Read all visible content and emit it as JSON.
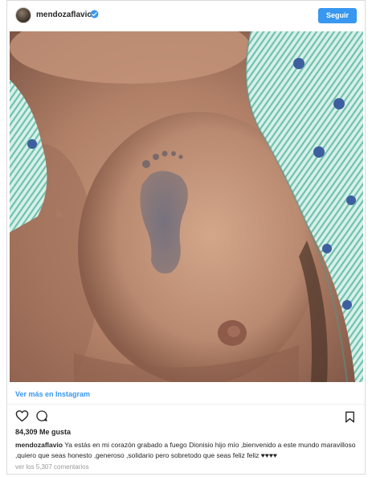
{
  "post": {
    "username": "mendozaflavio",
    "follow_label": "Seguir",
    "view_more": "Ver más en Instagram",
    "likes": "84,309 Me gusta",
    "caption_user": "mendozaflavio",
    "caption_text": "Ya estás en mi corazón grabado a fuego Dionisio hijo mío ,bienvenido a este mundo maravilloso ,quiero que seas honesto ,generoso ,solidario pero sobretodo que seas feliz feliz ♥♥♥♥",
    "view_comments": "ver los 5,307 comentarios"
  },
  "icons": {
    "verified": "verified-badge-icon",
    "like": "heart-icon",
    "comment": "comment-icon",
    "save": "bookmark-icon"
  },
  "colors": {
    "accent": "#3897f0",
    "text": "#262626",
    "muted": "#999999",
    "border": "#dbdbdb"
  }
}
